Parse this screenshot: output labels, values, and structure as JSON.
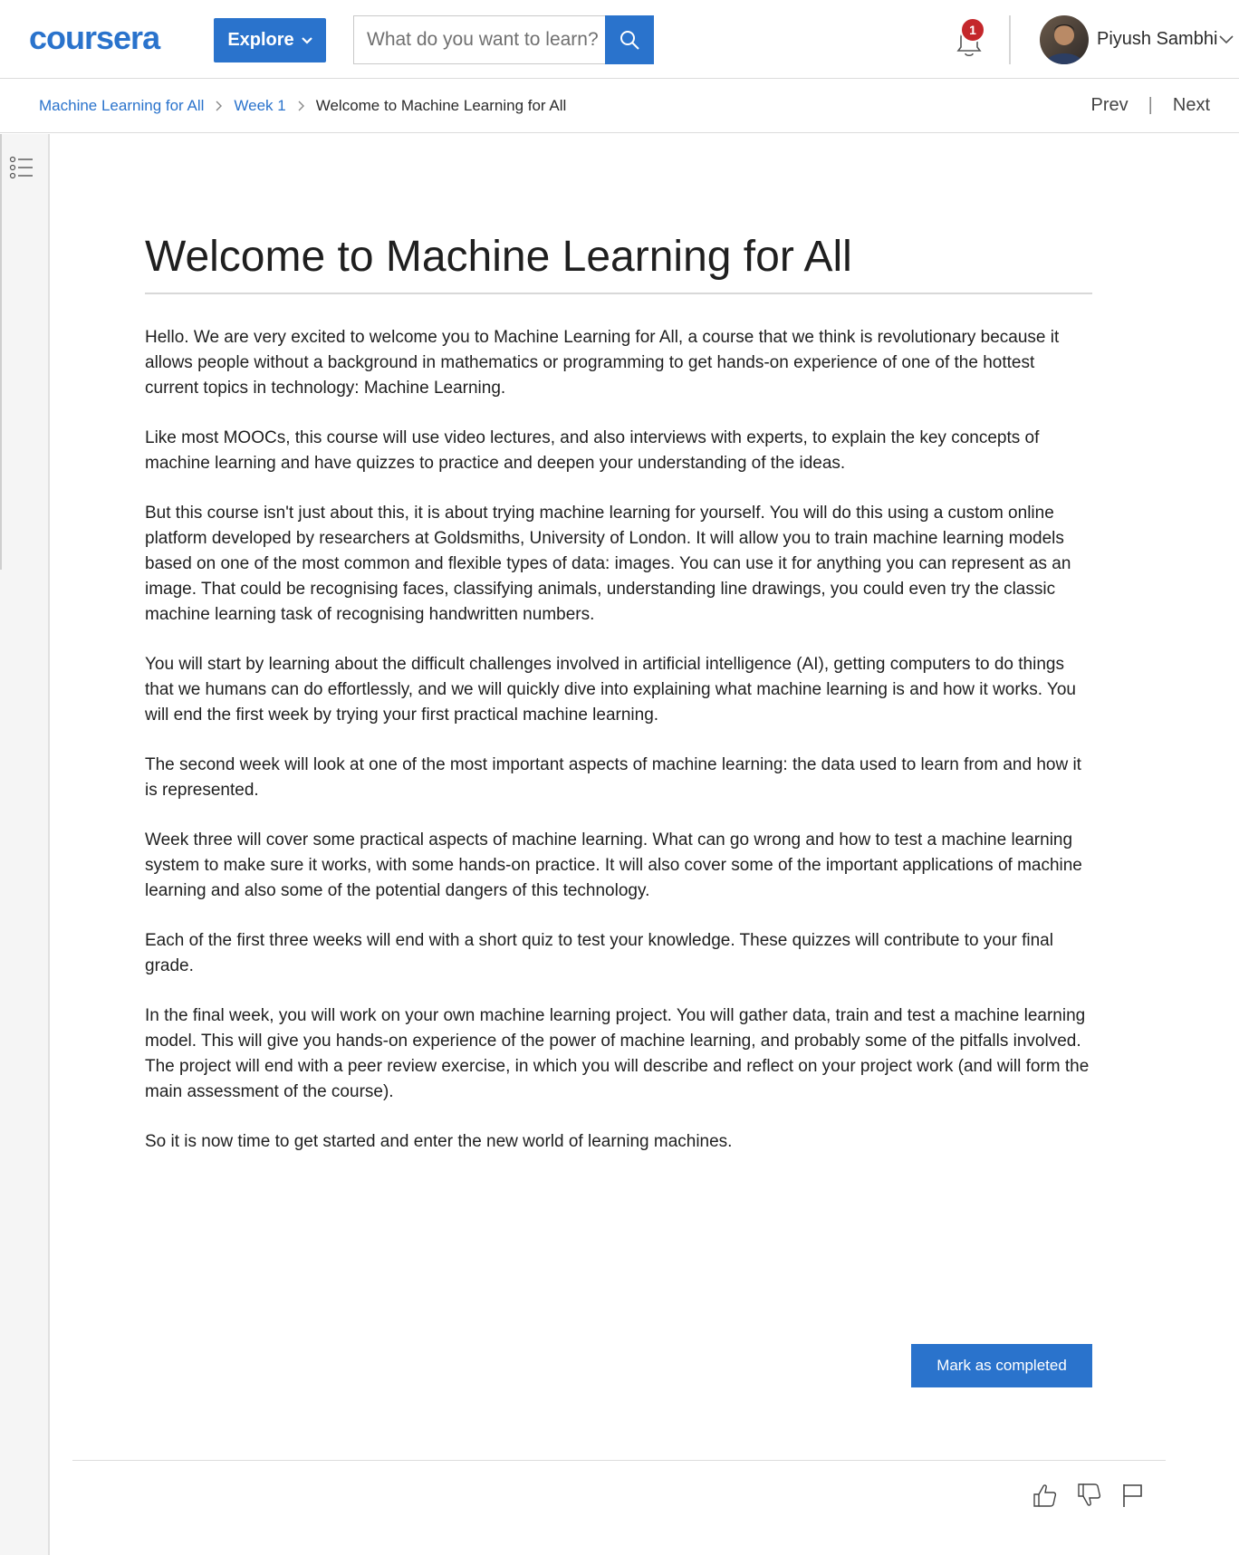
{
  "header": {
    "logo_text": "coursera",
    "explore_label": "Explore",
    "search_placeholder": "What do you want to learn?",
    "notification_count": "1",
    "user_name": "Piyush Sambhi"
  },
  "breadcrumb": {
    "items": [
      "Machine Learning for All",
      "Week 1"
    ],
    "current": "Welcome to Machine Learning for All"
  },
  "nav": {
    "prev": "Prev",
    "separator": "|",
    "next": "Next"
  },
  "main": {
    "title": "Welcome to Machine Learning for All",
    "paragraphs": [
      "Hello. We are very excited to welcome you to Machine Learning for All, a course that we think is revolutionary because it allows people without a background in mathematics or programming to get hands-on experience of one of the hottest current topics in technology: Machine Learning.",
      "Like most MOOCs, this course will use video lectures, and also interviews with experts, to explain the key concepts of machine learning and have quizzes to practice and deepen your understanding of the ideas.",
      "But this course isn't just about this, it is about trying machine learning for yourself. You will do this using a custom online platform developed by researchers at Goldsmiths, University of London. It will allow you to train machine learning models based on one of the most common and flexible types of data: images. You can use it for anything you can represent as an image. That could be recognising faces, classifying animals, understanding line drawings, you could even try the classic machine learning task of recognising handwritten numbers.",
      "You will start by learning about the difficult challenges involved in artificial intelligence (AI), getting computers to do things that we humans can do effortlessly, and we will quickly dive into explaining what machine learning is and how it works. You will end the first week by trying your first practical machine learning.",
      "The second week will look at one of the most important aspects of machine learning: the data used to learn from and how it is represented.",
      "Week three will cover some practical aspects of machine learning. What can go wrong and how to test a machine learning system to make sure it works, with some hands-on practice. It will also cover some of the important applications of machine learning and also some of the potential dangers of this technology.",
      "Each of the first three weeks will end with a short quiz to test your knowledge. These quizzes will contribute to your final grade.",
      "In the final week, you will work on your own machine learning project. You will gather data, train and test a machine learning model. This will give you hands-on experience of the power of machine learning, and probably some of the pitfalls involved. The project will end with a peer review exercise, in which you will describe and reflect on your project work (and will form the main assessment of the course).",
      "So it is now time to get started and enter the new world of learning machines."
    ],
    "mark_completed_label": "Mark as completed"
  },
  "icons": {
    "search": "search-icon",
    "notification": "bell-icon",
    "sidebar_toggle": "list-icon",
    "like": "thumbs-up-icon",
    "dislike": "thumbs-down-icon",
    "report": "flag-icon"
  },
  "colors": {
    "brand": "#2a73cc",
    "badge": "#c4272b"
  }
}
